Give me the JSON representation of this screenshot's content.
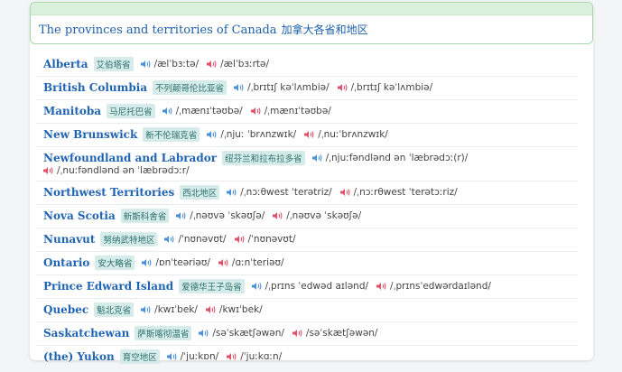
{
  "header": {
    "title": "The provinces and territories of Canada",
    "title_zh": "加拿大各省和地区"
  },
  "colors": {
    "us_speaker": "#4a90d9",
    "uk_speaker": "#e0506a",
    "name": "#1f63b3",
    "tag_bg": "#d6ecea"
  },
  "icons": {
    "us": "speaker-icon-blue",
    "uk": "speaker-icon-red"
  },
  "rows": [
    {
      "name": "Alberta",
      "zh": "艾伯塔省",
      "us": "/ælˈbɜːtə/",
      "uk": "/ælˈbɜːrtə/"
    },
    {
      "name": "British Columbia",
      "zh": "不列颠哥伦比亚省",
      "us": "/ˌbrɪtɪʃ kəˈlʌmbiə/",
      "uk": "/ˌbrɪtɪʃ kəˈlʌmbiə/"
    },
    {
      "name": "Manitoba",
      "zh": "马尼托巴省",
      "us": "/ˌmænɪˈtəʊbə/",
      "uk": "/ˌmænɪˈtəʊbə/"
    },
    {
      "name": "New Brunswick",
      "zh": "新不伦瑞克省",
      "us": "/ˌnjuː ˈbrʌnzwɪk/",
      "uk": "/ˌnuːˈbrʌnzwɪk/"
    },
    {
      "name": "Newfoundland and Labrador",
      "zh": "纽芬兰和拉布拉多省",
      "us": "/ˌnjuːfəndlənd ən ˈlæbrədɔː(r)/",
      "uk": "/ˌnuːfəndlənd ən ˈlæbrədɔːr/"
    },
    {
      "name": "Northwest Territories",
      "zh": "西北地区",
      "us": "/ˌnɔːθwest ˈterətriz/",
      "uk": "/ˌnɔːrθwest ˈterətɔːriz/"
    },
    {
      "name": "Nova Scotia",
      "zh": "新斯科舍省",
      "us": "/ˌnəʊvə ˈskəʊʃə/",
      "uk": "/ˌnəʊvə ˈskəʊʃə/"
    },
    {
      "name": "Nunavut",
      "zh": "努纳武特地区",
      "us": "/ˈnʊnəvʊt/",
      "uk": "/ˈnʊnəvʊt/"
    },
    {
      "name": "Ontario",
      "zh": "安大略省",
      "us": "/ɒnˈteəriəʊ/",
      "uk": "/ɑːnˈteriəʊ/"
    },
    {
      "name": "Prince Edward Island",
      "zh": "爱德华王子岛省",
      "us": "/ˌprɪns ˈedwəd aɪlənd/",
      "uk": "/ˌprɪnsˈedwərdaɪlənd/"
    },
    {
      "name": "Quebec",
      "zh": "魁北克省",
      "us": "/kwɪˈbek/",
      "uk": "/kwɪˈbek/"
    },
    {
      "name": "Saskatchewan",
      "zh": "萨斯喀彻温省",
      "us": "/səˈskætʃəwən/",
      "uk": "/səˈskætʃəwən/"
    },
    {
      "name": "(the) Yukon",
      "zh": "育空地区",
      "us": "/ˈjuːkɒn/",
      "uk": "/ˈjuːkɑːn/"
    }
  ]
}
